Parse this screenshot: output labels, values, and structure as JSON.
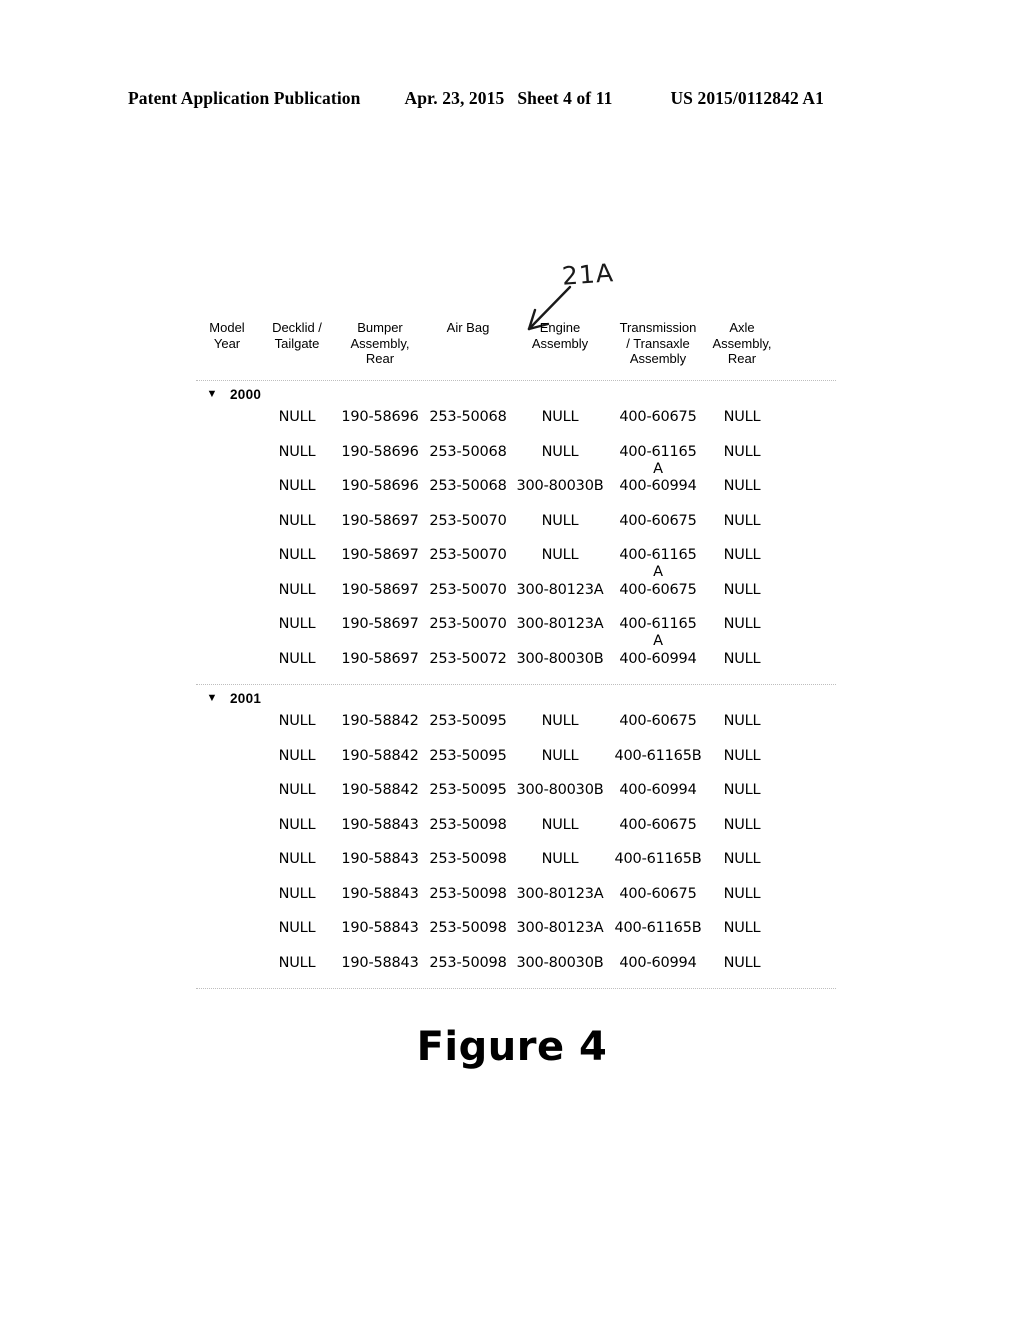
{
  "publication_header": {
    "title": "Patent Application Publication",
    "date": "Apr. 23, 2015",
    "sheet": "Sheet 4 of 11",
    "number": "US 2015/0112842 A1"
  },
  "annotation": {
    "label": "21A",
    "icon": "arrow-down-left-icon"
  },
  "table": {
    "columns": [
      "Model\nYear",
      "Decklid /\nTailgate",
      "Bumper\nAssembly,\nRear",
      "Air Bag",
      "Engine\nAssembly",
      "Transmission\n/ Transaxle\nAssembly",
      "Axle\nAssembly,\nRear"
    ],
    "groups": [
      {
        "twisty": "▼",
        "year": "2000",
        "rows": [
          [
            "",
            "NULL",
            "190-58696",
            "253-50068",
            "NULL",
            "400-60675",
            "NULL"
          ],
          [
            "",
            "NULL",
            "190-58696",
            "253-50068",
            "NULL",
            "400-61165\nA",
            "NULL"
          ],
          [
            "",
            "NULL",
            "190-58696",
            "253-50068",
            "300-80030B",
            "400-60994",
            "NULL"
          ],
          [
            "",
            "NULL",
            "190-58697",
            "253-50070",
            "NULL",
            "400-60675",
            "NULL"
          ],
          [
            "",
            "NULL",
            "190-58697",
            "253-50070",
            "NULL",
            "400-61165\nA",
            "NULL"
          ],
          [
            "",
            "NULL",
            "190-58697",
            "253-50070",
            "300-80123A",
            "400-60675",
            "NULL"
          ],
          [
            "",
            "NULL",
            "190-58697",
            "253-50070",
            "300-80123A",
            "400-61165\nA",
            "NULL"
          ],
          [
            "",
            "NULL",
            "190-58697",
            "253-50072",
            "300-80030B",
            "400-60994",
            "NULL"
          ]
        ]
      },
      {
        "twisty": "▼",
        "year": "2001",
        "rows": [
          [
            "",
            "NULL",
            "190-58842",
            "253-50095",
            "NULL",
            "400-60675",
            "NULL"
          ],
          [
            "",
            "NULL",
            "190-58842",
            "253-50095",
            "NULL",
            "400-61165B",
            "NULL"
          ],
          [
            "",
            "NULL",
            "190-58842",
            "253-50095",
            "300-80030B",
            "400-60994",
            "NULL"
          ],
          [
            "",
            "NULL",
            "190-58843",
            "253-50098",
            "NULL",
            "400-60675",
            "NULL"
          ],
          [
            "",
            "NULL",
            "190-58843",
            "253-50098",
            "NULL",
            "400-61165B",
            "NULL"
          ],
          [
            "",
            "NULL",
            "190-58843",
            "253-50098",
            "300-80123A",
            "400-60675",
            "NULL"
          ],
          [
            "",
            "NULL",
            "190-58843",
            "253-50098",
            "300-80123A",
            "400-61165B",
            "NULL"
          ],
          [
            "",
            "NULL",
            "190-58843",
            "253-50098",
            "300-80030B",
            "400-60994",
            "NULL"
          ]
        ]
      }
    ]
  },
  "figure_caption": "Figure 4"
}
